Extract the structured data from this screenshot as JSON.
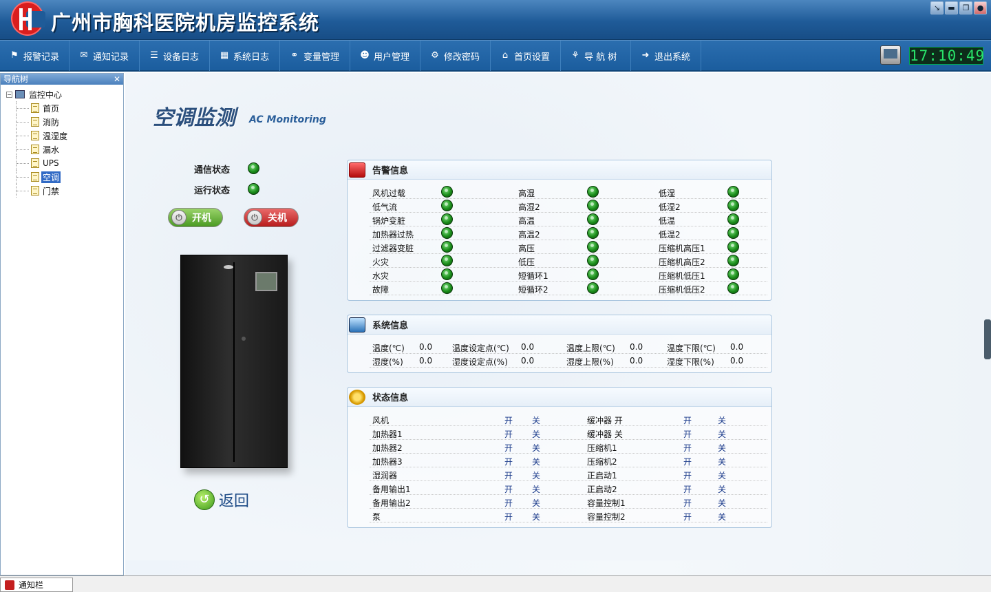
{
  "app": {
    "title": "广州市胸科医院机房监控系统",
    "clock": "17:10:49"
  },
  "window_buttons": [
    "minimize-to-tray",
    "minimize",
    "restore",
    "close"
  ],
  "toolbar": [
    {
      "label": "报警记录",
      "icon": "flag-icon"
    },
    {
      "label": "通知记录",
      "icon": "envelope-icon"
    },
    {
      "label": "设备日志",
      "icon": "list-icon"
    },
    {
      "label": "系统日志",
      "icon": "calendar-icon"
    },
    {
      "label": "变量管理",
      "icon": "link-icon"
    },
    {
      "label": "用户管理",
      "icon": "users-icon"
    },
    {
      "label": "修改密码",
      "icon": "gear-icon"
    },
    {
      "label": "首页设置",
      "icon": "home-icon"
    },
    {
      "label": "导 航 树",
      "icon": "tree-icon"
    },
    {
      "label": "退出系统",
      "icon": "arrow-right-icon"
    }
  ],
  "nav": {
    "title": "导航树",
    "root": "监控中心",
    "items": [
      "首页",
      "消防",
      "温湿度",
      "漏水",
      "UPS",
      "空调",
      "门禁"
    ],
    "selected": "空调"
  },
  "page": {
    "title": "空调监测",
    "subtitle": "AC Monitoring",
    "comm_status_label": "通信状态",
    "run_status_label": "运行状态",
    "power_on": "开机",
    "power_off": "关机",
    "back": "返回"
  },
  "alarm": {
    "title": "告警信息",
    "items": [
      [
        "风机过载",
        "高湿",
        "低湿"
      ],
      [
        "低气流",
        "高湿2",
        "低湿2"
      ],
      [
        "锅炉变脏",
        "高温",
        "低温"
      ],
      [
        "加热器过热",
        "高温2",
        "低温2"
      ],
      [
        "过滤器变脏",
        "高压",
        "压缩机高压1"
      ],
      [
        "火灾",
        "低压",
        "压缩机高压2"
      ],
      [
        "水灾",
        "短循环1",
        "压缩机低压1"
      ],
      [
        "故障",
        "短循环2",
        "压缩机低压2"
      ]
    ],
    "status_color": "#1a8c1a"
  },
  "system": {
    "title": "系统信息",
    "rows": [
      [
        {
          "label": "温度(℃)",
          "value": "0.0"
        },
        {
          "label": "温度设定点(℃)",
          "value": "0.0"
        },
        {
          "label": "温度上限(℃)",
          "value": "0.0"
        },
        {
          "label": "温度下限(℃)",
          "value": "0.0"
        }
      ],
      [
        {
          "label": "湿度(%)",
          "value": "0.0"
        },
        {
          "label": "湿度设定点(%)",
          "value": "0.0"
        },
        {
          "label": "湿度上限(%)",
          "value": "0.0"
        },
        {
          "label": "湿度下限(%)",
          "value": "0.0"
        }
      ]
    ]
  },
  "state": {
    "title": "状态信息",
    "on_label": "开",
    "off_label": "关",
    "rows": [
      [
        "风机",
        "缓冲器 开"
      ],
      [
        "加热器1",
        "缓冲器 关"
      ],
      [
        "加热器2",
        "压缩机1"
      ],
      [
        "加热器3",
        "压缩机2"
      ],
      [
        "湿润器",
        "正启动1"
      ],
      [
        "备用输出1",
        "正启动2"
      ],
      [
        "备用输出2",
        "容量控制1"
      ],
      [
        "泵",
        "容量控制2"
      ]
    ]
  },
  "statusbar": {
    "label": "通知栏"
  },
  "colors": {
    "title_bar": "#1f5b98",
    "toolbar": "#1b5d9e",
    "accent_text": "#2b4f7d",
    "clock": "#29e36a"
  }
}
